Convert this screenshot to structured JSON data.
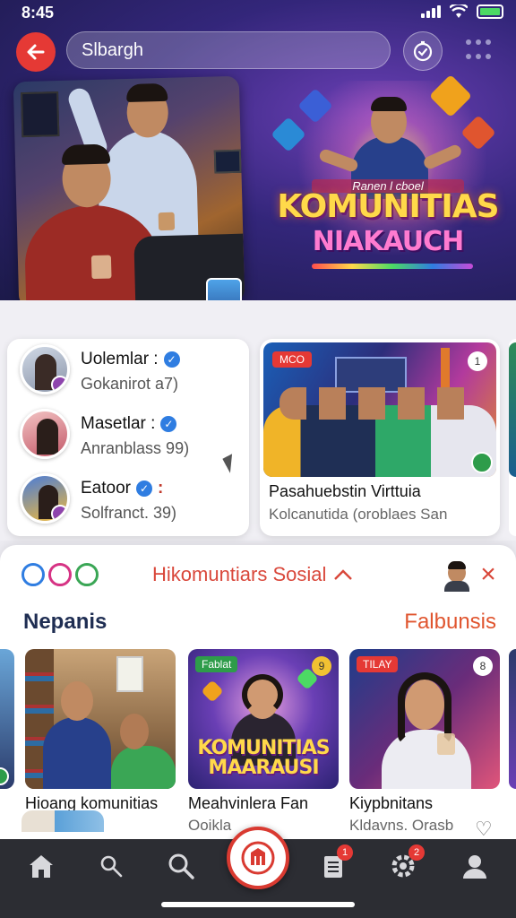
{
  "status_bar": {
    "time": "8:45"
  },
  "search": {
    "value": "Slbargh"
  },
  "hero": {
    "poster_subtitle": "Ranen l cboel",
    "poster_title_line1": "KOMUNITIAS",
    "poster_title_line2": "NIAKAUCH"
  },
  "list_card": {
    "items": [
      {
        "title": "Uolemlar :",
        "subtitle": "Gokanirot  a7)",
        "mark": ""
      },
      {
        "title": "Masetlar :",
        "subtitle": "Anranblass 99)",
        "mark": ""
      },
      {
        "title": "Eatoor",
        "subtitle": "Solfranct. 39)",
        "mark": ":"
      }
    ]
  },
  "featured_card": {
    "tag": "MCO",
    "icon_text": "1",
    "title": "Pasahuebstin Virttuia",
    "subtitle": "Kolcanutida (oroblaes San"
  },
  "panel": {
    "heading": "Hikomuntiars Sosial",
    "section_left": "Nepanis",
    "section_right": "Falbunsis",
    "tiles": [
      {
        "tag": "",
        "icon_text": "",
        "poster": "",
        "title": "Hioang komunitias",
        "subtitle": ""
      },
      {
        "tag": "Fablat",
        "icon_text": "9",
        "poster": "KOMUNITIAS MAARAUSI",
        "title": "Meahvinlera Fan",
        "subtitle": "Ooikla"
      },
      {
        "tag": "TILAY",
        "icon_text": "8",
        "poster": "",
        "title": "Kiypbnitans",
        "subtitle": "Kldavns. Orasb"
      }
    ]
  },
  "nav": {
    "badges": {
      "list": "1",
      "settings": "2"
    }
  },
  "colors": {
    "accent_red": "#e53935",
    "heading_red": "#d9473a",
    "verified_blue": "#2f7de1",
    "nav_bg": "#2c2d33"
  }
}
